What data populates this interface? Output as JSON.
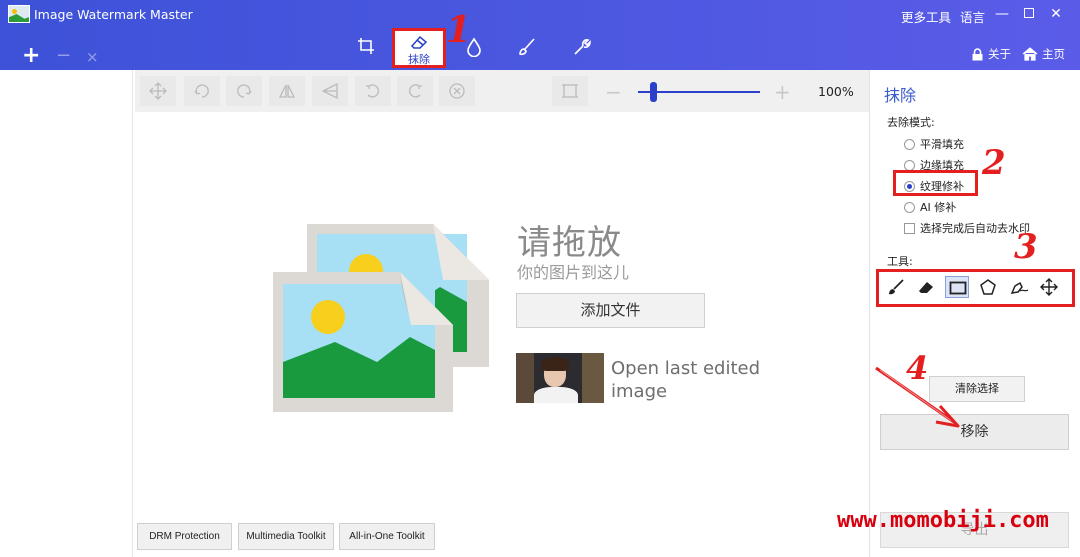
{
  "window": {
    "title": "Image Watermark Master",
    "more_tools": "更多工具",
    "language": "语言",
    "minimize": "—",
    "close": "✕"
  },
  "file_bar": {
    "add": "+",
    "remove": "−",
    "close": "×"
  },
  "modes": [
    {
      "name": "crop",
      "icon": "crop-icon"
    },
    {
      "name": "erase",
      "label": "抹除",
      "icon": "eraser-icon",
      "selected": true
    },
    {
      "name": "watermark",
      "icon": "drop-icon"
    },
    {
      "name": "brush",
      "icon": "brush-icon"
    },
    {
      "name": "tools",
      "icon": "wrench-icon"
    }
  ],
  "header_links": {
    "about": "关于",
    "home": "主页"
  },
  "annotations": {
    "n1": "1",
    "n2": "2",
    "n3": "3",
    "n4": "4"
  },
  "toolbar": {
    "tools": [
      "move-icon",
      "rotate-left-icon",
      "rotate-right-icon",
      "flip-horizontal-icon",
      "flip-vertical-icon",
      "undo-icon",
      "redo-icon",
      "cancel-icon"
    ],
    "zoom_minus": "−",
    "zoom_plus": "+",
    "zoom_value": "100%",
    "zoom_level": 0.1
  },
  "drop_area": {
    "title": "请拖放",
    "subtitle": "你的图片到这儿",
    "add_file": "添加文件",
    "open_last": "Open last edited image"
  },
  "bottom_buttons": [
    "DRM Protection",
    "Multimedia Toolkit",
    "All-in-One Toolkit"
  ],
  "right_panel": {
    "title": "抹除",
    "mode_label": "去除模式:",
    "modes": [
      {
        "label": "平滑填充",
        "checked": false
      },
      {
        "label": "边缘填充",
        "checked": false
      },
      {
        "label": "纹理修补",
        "checked": true
      },
      {
        "label": "AI 修补",
        "checked": false
      }
    ],
    "auto_remove": "选择完成后自动去水印",
    "tools_label": "工具:",
    "tools": [
      "brush-icon",
      "eraser-icon",
      "rectangle-select-icon",
      "polygon-select-icon",
      "magic-pen-icon",
      "move-icon"
    ],
    "clear_selection": "清除选择",
    "remove": "移除",
    "export": "导出"
  },
  "site_watermark": "www.momobiji.com",
  "colors": {
    "titlebar": "#4354dc",
    "accent": "#2a40c8",
    "annotation": "#e41f1f",
    "watermark": "#d8000f"
  }
}
